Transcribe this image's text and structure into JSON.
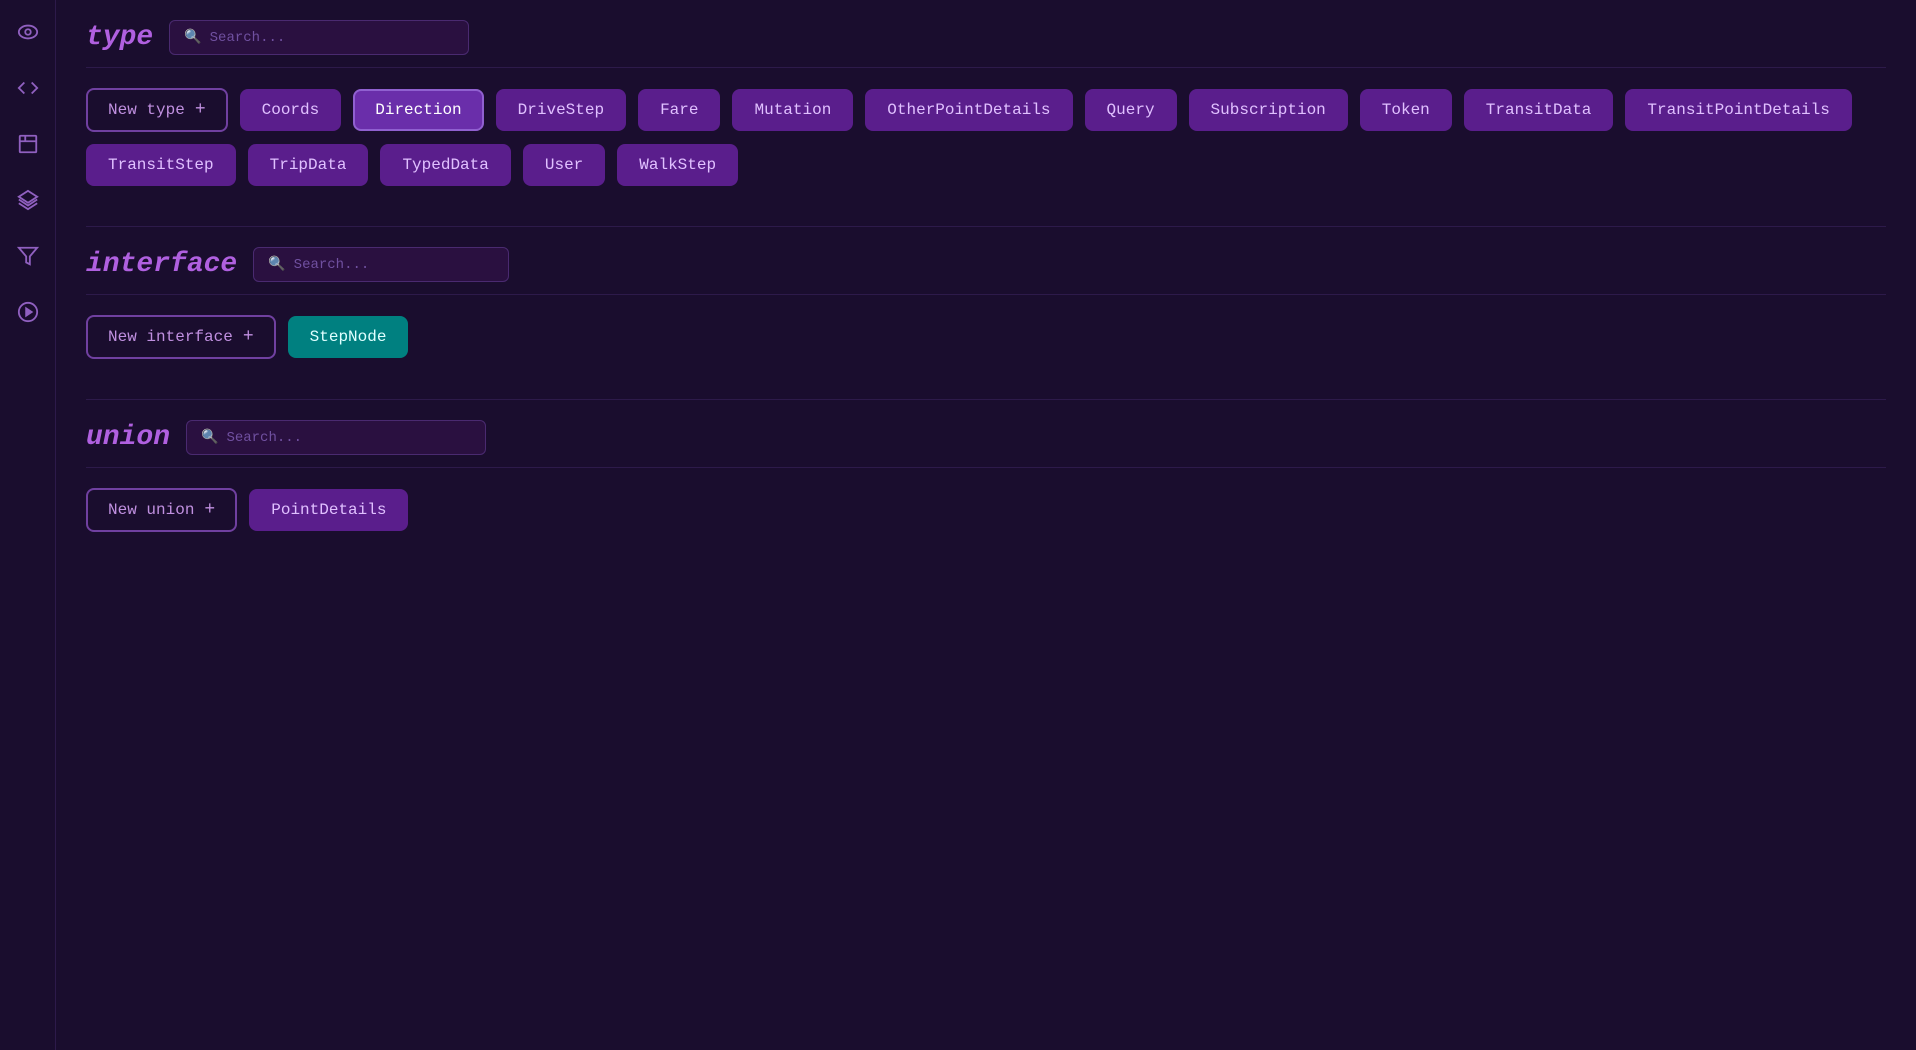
{
  "sidebar": {
    "icons": [
      {
        "name": "eye-icon",
        "symbol": "👁",
        "interactable": true
      },
      {
        "name": "code-icon",
        "symbol": "<>",
        "interactable": true
      },
      {
        "name": "frame-icon",
        "symbol": "⬚",
        "interactable": true
      },
      {
        "name": "layers-icon",
        "symbol": "≡",
        "interactable": true
      },
      {
        "name": "filter-icon",
        "symbol": "⊽",
        "interactable": true
      },
      {
        "name": "play-icon",
        "symbol": "▶",
        "interactable": true
      }
    ]
  },
  "sections": {
    "type": {
      "title": "type",
      "search_placeholder": "Search...",
      "new_button_label": "New type",
      "plus_label": "+",
      "tags": [
        "Coords",
        "Direction",
        "DriveStep",
        "Fare",
        "Mutation",
        "OtherPointDetails",
        "Query",
        "Subscription",
        "Token",
        "TransitData",
        "TransitPointDetails",
        "TransitStep",
        "TripData",
        "TypedData",
        "User",
        "WalkStep"
      ],
      "active_tag": "Direction"
    },
    "interface": {
      "title": "interface",
      "search_placeholder": "Search...",
      "new_button_label": "New interface",
      "plus_label": "+",
      "tags": [
        "StepNode"
      ]
    },
    "union": {
      "title": "union",
      "search_placeholder": "Search...",
      "new_button_label": "New union",
      "plus_label": "+",
      "tags": [
        "PointDetails"
      ]
    }
  }
}
